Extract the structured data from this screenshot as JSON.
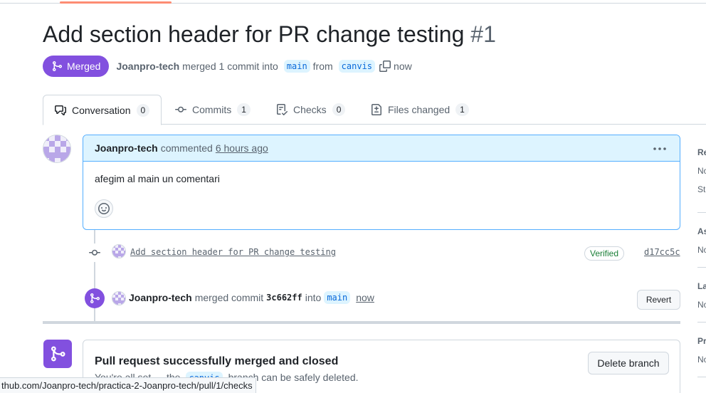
{
  "pr": {
    "title": "Add section header for PR change testing",
    "number": "#1",
    "state": "Merged",
    "author": "Joanpro-tech",
    "summary": "merged 1 commit into",
    "base_branch": "main",
    "from_label": "from",
    "head_branch": "canvis",
    "time": "now"
  },
  "tabs": [
    {
      "label": "Conversation",
      "count": "0",
      "icon": "comment-discussion-icon"
    },
    {
      "label": "Commits",
      "count": "1",
      "icon": "git-commit-icon"
    },
    {
      "label": "Checks",
      "count": "0",
      "icon": "checklist-icon"
    },
    {
      "label": "Files changed",
      "count": "1",
      "icon": "file-diff-icon"
    }
  ],
  "comment": {
    "author": "Joanpro-tech",
    "action": "commented",
    "time": "6 hours ago",
    "body": "afegim al main un comentari"
  },
  "timeline": {
    "commit": {
      "message": "Add section header for PR change testing",
      "badge": "Verified",
      "sha": "d17cc5c"
    },
    "merge": {
      "author": "Joanpro-tech",
      "action": "merged commit",
      "sha": "3c662ff",
      "into": "into",
      "branch": "main",
      "time": "now",
      "revert_label": "Revert"
    }
  },
  "merge_box": {
    "title": "Pull request successfully merged and closed",
    "sub_before": "You're all set — the",
    "sub_branch": "canvis",
    "sub_after": "branch can be safely deleted.",
    "delete_label": "Delete branch"
  },
  "sidebar": {
    "reviewers": {
      "head": "Re",
      "lines": [
        "No",
        "St"
      ]
    },
    "assignees": {
      "head": "As",
      "lines": [
        "No"
      ]
    },
    "labels": {
      "head": "La",
      "lines": [
        "No"
      ]
    },
    "projects": {
      "head": "Pr",
      "lines": [
        "No"
      ]
    }
  },
  "statusbar": "thub.com/Joanpro-tech/practica-2-Joanpro-tech/pull/1/checks",
  "colors": {
    "merged": "#8250df",
    "link": "#0969da",
    "verified": "#1a7f37",
    "comment_header": "#ddf4ff",
    "tab_accent": "#fd8c73"
  }
}
